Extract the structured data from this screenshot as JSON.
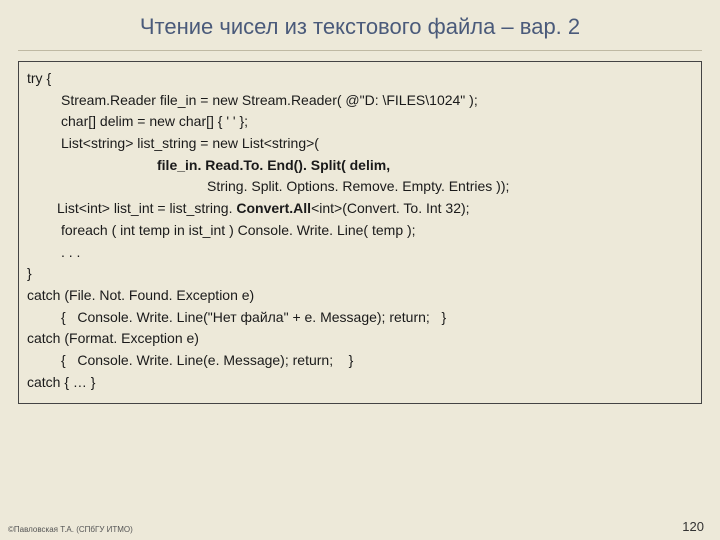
{
  "title": "Чтение чисел из текстового файла – вар. 2",
  "code": {
    "l1": "try {",
    "l2": "Stream.Reader file_in = new Stream.Reader( @\"D: \\FILES\\1024\" );",
    "l3": "char[] delim = new char[] { ' ' };",
    "l4": "List<string> list_string = new List<string>(",
    "l5": "file_in. Read.To. End(). Split( delim,",
    "l6": "String. Split. Options. Remove. Empty. Entries ));",
    "l7a": "List<int> list_int = list_string. ",
    "l7b": "Convert.All",
    "l7c": "<int>(Convert. To. Int 32);",
    "l8": "foreach ( int temp in ist_int ) Console. Write. Line( temp );",
    "l9": ". . .",
    "l10": "}",
    "l11": "catch (File. Not. Found. Exception e)",
    "l12": "{   Console. Write. Line(\"Нет файла\" + e. Message); return;   }",
    "l13": "catch (Format. Exception e)",
    "l14": "{   Console. Write. Line(e. Message); return;    }",
    "l15": "catch { … }"
  },
  "footer": "©Павловская Т.А. (СПбГУ ИТМО)",
  "page": "120"
}
